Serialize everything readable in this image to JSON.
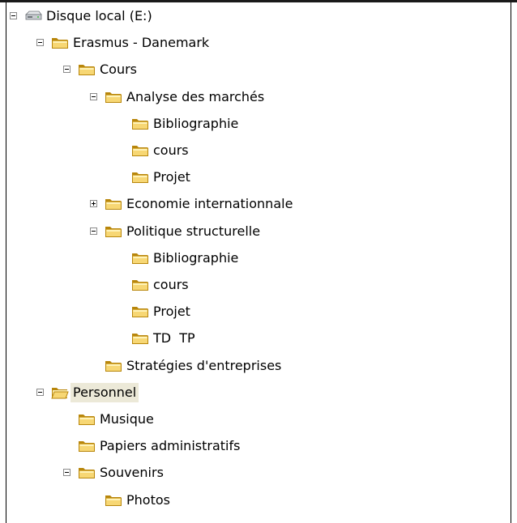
{
  "tree": [
    {
      "id": "disque-local-e",
      "label": "Disque local (E:)",
      "icon": "drive-icon",
      "level": 0,
      "expander": "minus",
      "selected": false
    },
    {
      "id": "erasmus-danemark",
      "label": "Erasmus - Danemark",
      "icon": "folder-icon",
      "level": 1,
      "expander": "minus",
      "selected": false
    },
    {
      "id": "cours",
      "label": "Cours",
      "icon": "folder-icon",
      "level": 2,
      "expander": "minus",
      "selected": false
    },
    {
      "id": "analyse-des-marches",
      "label": "Analyse des marchés",
      "icon": "folder-icon",
      "level": 3,
      "expander": "minus",
      "selected": false
    },
    {
      "id": "bibliographie-1",
      "label": "Bibliographie",
      "icon": "folder-icon",
      "level": 4,
      "expander": "none",
      "selected": false
    },
    {
      "id": "cours-1",
      "label": "cours",
      "icon": "folder-icon",
      "level": 4,
      "expander": "none",
      "selected": false
    },
    {
      "id": "projet-1",
      "label": "Projet",
      "icon": "folder-icon",
      "level": 4,
      "expander": "none",
      "selected": false
    },
    {
      "id": "economie-internationnale",
      "label": "Economie internationnale",
      "icon": "folder-icon",
      "level": 3,
      "expander": "plus",
      "selected": false
    },
    {
      "id": "politique-structurelle",
      "label": "Politique structurelle",
      "icon": "folder-icon",
      "level": 3,
      "expander": "minus",
      "selected": false
    },
    {
      "id": "bibliographie-2",
      "label": "Bibliographie",
      "icon": "folder-icon",
      "level": 4,
      "expander": "none",
      "selected": false
    },
    {
      "id": "cours-2",
      "label": "cours",
      "icon": "folder-icon",
      "level": 4,
      "expander": "none",
      "selected": false
    },
    {
      "id": "projet-2",
      "label": "Projet",
      "icon": "folder-icon",
      "level": 4,
      "expander": "none",
      "selected": false
    },
    {
      "id": "td-tp",
      "label": "TD  TP",
      "icon": "folder-icon",
      "level": 4,
      "expander": "none",
      "selected": false
    },
    {
      "id": "strategies-d-entreprises",
      "label": "Stratégies d'entreprises",
      "icon": "folder-icon",
      "level": 3,
      "expander": "none",
      "selected": false
    },
    {
      "id": "personnel",
      "label": "Personnel",
      "icon": "folder-open-icon",
      "level": 1,
      "expander": "minus",
      "selected": true
    },
    {
      "id": "musique",
      "label": "Musique",
      "icon": "folder-icon",
      "level": 2,
      "expander": "none",
      "selected": false
    },
    {
      "id": "papiers-administratifs",
      "label": "Papiers administratifs",
      "icon": "folder-icon",
      "level": 2,
      "expander": "none",
      "selected": false
    },
    {
      "id": "souvenirs",
      "label": "Souvenirs",
      "icon": "folder-icon",
      "level": 2,
      "expander": "minus",
      "selected": false
    },
    {
      "id": "photos",
      "label": "Photos",
      "icon": "folder-icon",
      "level": 3,
      "expander": "none",
      "selected": false
    }
  ],
  "colors": {
    "selection": "#ece9d8",
    "folder_fill": "#f7d774",
    "folder_dark": "#b8860b",
    "folder_light": "#fff3b8",
    "drive_body": "#c9ccd1",
    "drive_dark": "#6e7378",
    "text": "#000000",
    "expander_border": "#8a8a8a"
  }
}
